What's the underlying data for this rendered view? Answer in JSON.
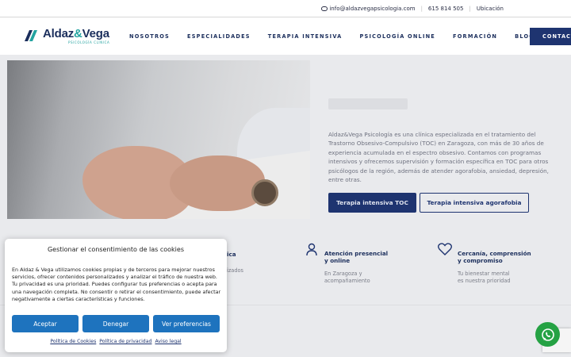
{
  "topbar": {
    "email": "info@aldazvegapsicologia.com",
    "phone": "615 814 505",
    "location": "Ubicación"
  },
  "logo": {
    "name_part1": "Aldaz",
    "name_amp": "&",
    "name_part2": "Vega",
    "subtitle": "PSICOLOGÍA CLÍNICA"
  },
  "nav": {
    "items": [
      "NOSOTROS",
      "ESPECIALIDADES",
      "TERAPIA INTENSIVA",
      "PSICOLOGÍA ONLINE",
      "FORMACIÓN",
      "BLOG"
    ],
    "contact": "CONTACTO"
  },
  "hero": {
    "description": "Aldaz&Vega Psicología es una clínica especializada en el tratamiento del Trastorno Obsesivo-Compulsivo (TOC) en Zaragoza, con más de 30 años de experiencia acumulada en el espectro obsesivo. Contamos con programas intensivos y ofrecemos supervisión y formación específica en TOC para otros psicólogos de la región, además de atender agorafobia, ansiedad, depresión, entre otras.",
    "btn_primary": "Terapia intensiva TOC",
    "btn_outline": "Terapia intensiva agorafobia"
  },
  "features": {
    "partial_title": "ica",
    "partial_sub": "izados",
    "items": [
      {
        "title_line1": "Atención presencial",
        "title_line2": "y online",
        "sub_line1": "En Zaragoza y",
        "sub_line2": "acompañamiento"
      },
      {
        "title_line1": "Cercanía, comprensión",
        "title_line2": "y compromiso",
        "sub_line1": "Tu bienestar mental",
        "sub_line2": "es nuestra prioridad"
      }
    ]
  },
  "cookie": {
    "title": "Gestionar el consentimiento de las cookies",
    "body": "En Aldaz & Vega utilizamos cookies propias y de terceros para mejorar nuestros servicios, ofrecer contenidos personalizados y analizar el tráfico de nuestra web. Tu privacidad es una prioridad. Puedes configurar tus preferencias o acepta para una navegación completa. No consentir o retirar el consentimiento, puede afectar negativamente a ciertas características y funciones.",
    "accept": "Aceptar",
    "deny": "Denegar",
    "preferences": "Ver preferencias",
    "links": [
      "Política de Cookies",
      "Política de privacidad",
      "Aviso legal"
    ]
  },
  "colors": {
    "navy": "#1e3470",
    "teal": "#23a3a0",
    "cookie_button": "#1e73be",
    "whatsapp": "#25a244"
  },
  "icons": [
    "mail-icon",
    "location-pin-icon",
    "heart-icon",
    "whatsapp-icon",
    "recaptcha-icon"
  ]
}
